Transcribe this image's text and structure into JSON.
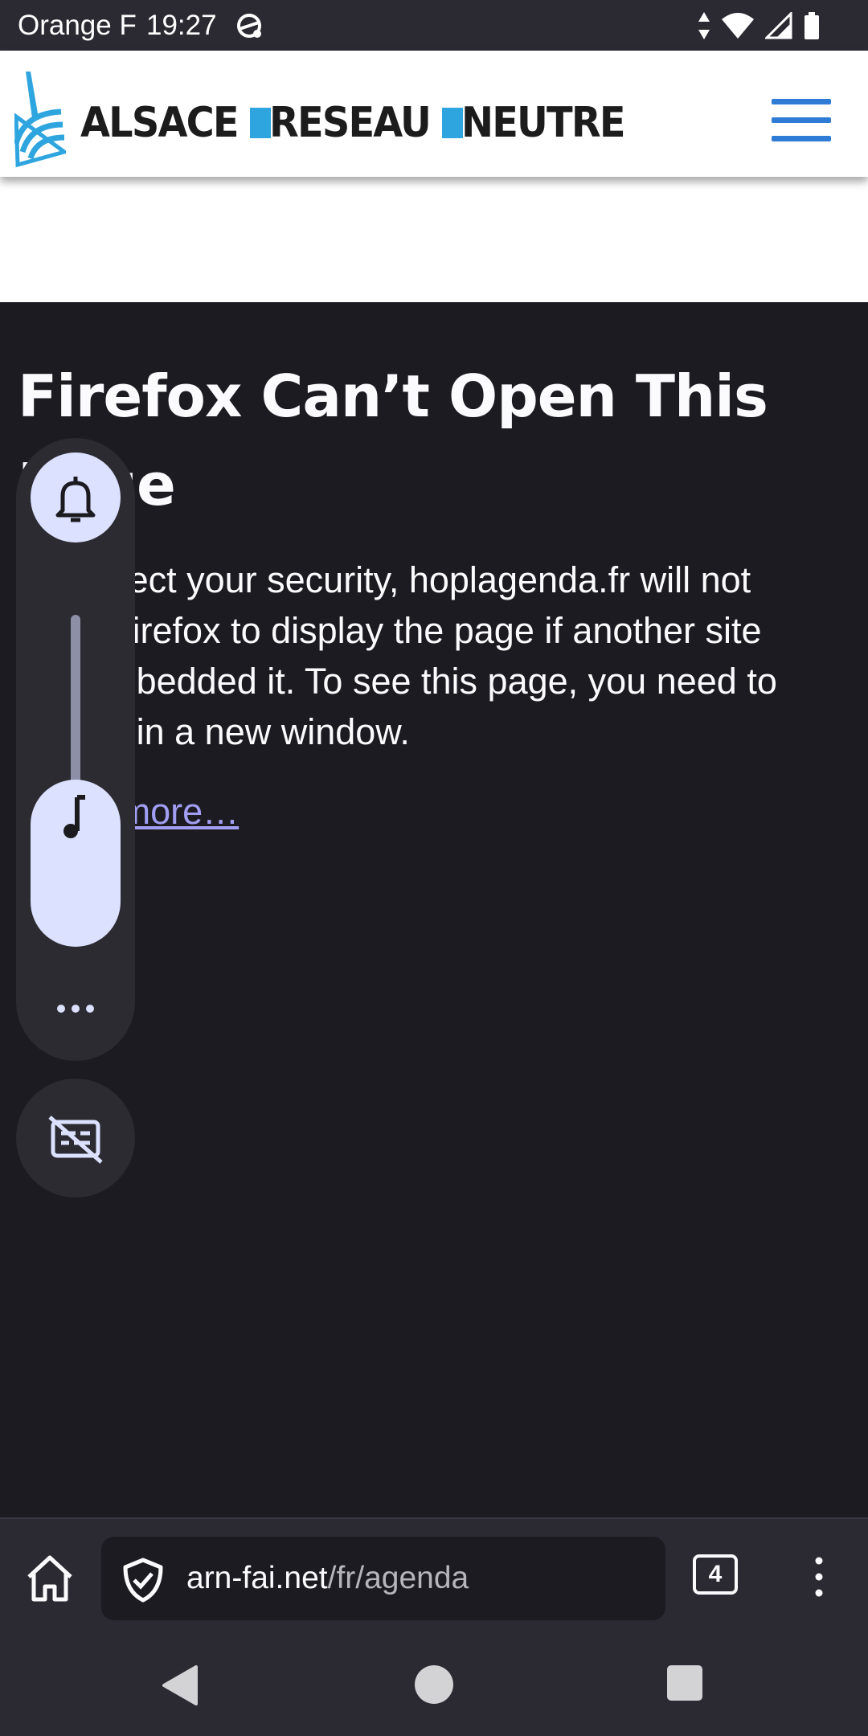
{
  "status_bar": {
    "carrier": "Orange F",
    "time": "19:27",
    "icons": [
      "sync-icon",
      "data-arrows-icon",
      "wifi-icon",
      "cell-signal-icon",
      "battery-icon"
    ]
  },
  "site": {
    "brand_words": [
      "ALSACE",
      "RESEAU",
      "NEUTRE"
    ],
    "brand_colors": {
      "dark": "#1c1c1c",
      "accent": "#2fa5e0",
      "menu": "#2e7cd6"
    },
    "menu_icon": "hamburger-menu-icon"
  },
  "error_page": {
    "title": "Firefox Can’t Open This Page",
    "message": "To protect your security, hoplagenda.fr will not allow Firefox to display the page if another site has embedded it. To see this page, you need to open it in a new window.",
    "learn_more": "Learn more…"
  },
  "volume_panel": {
    "ring_icon": "bell-icon",
    "media_icon": "music-note-icon",
    "more_icon": "more-dots-icon",
    "caption_icon": "captions-off-icon",
    "media_level": 0.4
  },
  "toolbar": {
    "home_icon": "home-icon",
    "security_icon": "shield-check-icon",
    "url_host": "arn-fai.net",
    "url_path": "/fr/agenda",
    "tab_count": "4",
    "menu_icon": "kebab-menu-icon"
  },
  "navbar": {
    "icons": [
      "back-triangle-icon",
      "home-circle-icon",
      "recents-square-icon"
    ]
  }
}
